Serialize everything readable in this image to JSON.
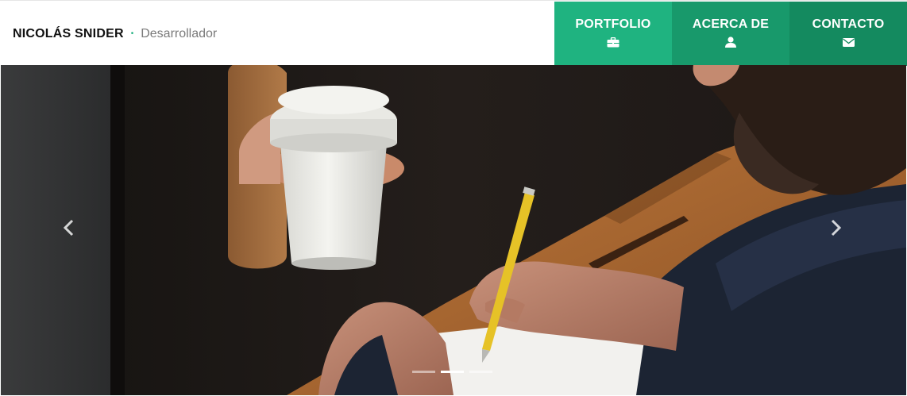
{
  "header": {
    "brand_name": "NICOLÁS SNIDER",
    "separator": "•",
    "role": "Desarrollador"
  },
  "nav": {
    "items": [
      {
        "label": "PORTFOLIO",
        "icon": "briefcase-icon",
        "color": "#1fb380"
      },
      {
        "label": "ACERCA DE",
        "icon": "user-icon",
        "color": "#18996b"
      },
      {
        "label": "CONTACTO",
        "icon": "envelope-icon",
        "color": "#148a5f"
      }
    ]
  },
  "carousel": {
    "slide_count": 3,
    "active_index": 1,
    "prev_icon": "chevron-left-icon",
    "next_icon": "chevron-right-icon"
  }
}
